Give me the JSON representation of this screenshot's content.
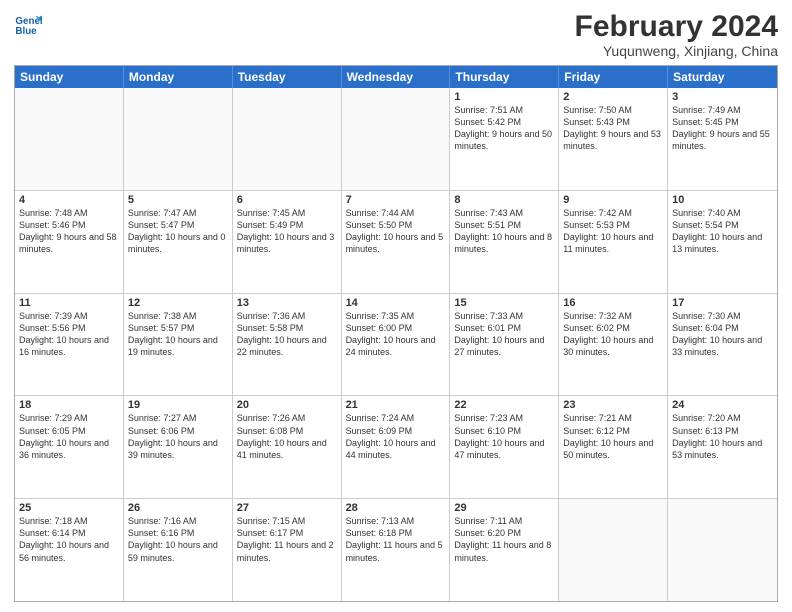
{
  "header": {
    "logo_line1": "General",
    "logo_line2": "Blue",
    "month_year": "February 2024",
    "location": "Yuqunweng, Xinjiang, China"
  },
  "days_of_week": [
    "Sunday",
    "Monday",
    "Tuesday",
    "Wednesday",
    "Thursday",
    "Friday",
    "Saturday"
  ],
  "rows": [
    [
      {
        "day": "",
        "info": ""
      },
      {
        "day": "",
        "info": ""
      },
      {
        "day": "",
        "info": ""
      },
      {
        "day": "",
        "info": ""
      },
      {
        "day": "1",
        "info": "Sunrise: 7:51 AM\nSunset: 5:42 PM\nDaylight: 9 hours and 50 minutes."
      },
      {
        "day": "2",
        "info": "Sunrise: 7:50 AM\nSunset: 5:43 PM\nDaylight: 9 hours and 53 minutes."
      },
      {
        "day": "3",
        "info": "Sunrise: 7:49 AM\nSunset: 5:45 PM\nDaylight: 9 hours and 55 minutes."
      }
    ],
    [
      {
        "day": "4",
        "info": "Sunrise: 7:48 AM\nSunset: 5:46 PM\nDaylight: 9 hours and 58 minutes."
      },
      {
        "day": "5",
        "info": "Sunrise: 7:47 AM\nSunset: 5:47 PM\nDaylight: 10 hours and 0 minutes."
      },
      {
        "day": "6",
        "info": "Sunrise: 7:45 AM\nSunset: 5:49 PM\nDaylight: 10 hours and 3 minutes."
      },
      {
        "day": "7",
        "info": "Sunrise: 7:44 AM\nSunset: 5:50 PM\nDaylight: 10 hours and 5 minutes."
      },
      {
        "day": "8",
        "info": "Sunrise: 7:43 AM\nSunset: 5:51 PM\nDaylight: 10 hours and 8 minutes."
      },
      {
        "day": "9",
        "info": "Sunrise: 7:42 AM\nSunset: 5:53 PM\nDaylight: 10 hours and 11 minutes."
      },
      {
        "day": "10",
        "info": "Sunrise: 7:40 AM\nSunset: 5:54 PM\nDaylight: 10 hours and 13 minutes."
      }
    ],
    [
      {
        "day": "11",
        "info": "Sunrise: 7:39 AM\nSunset: 5:56 PM\nDaylight: 10 hours and 16 minutes."
      },
      {
        "day": "12",
        "info": "Sunrise: 7:38 AM\nSunset: 5:57 PM\nDaylight: 10 hours and 19 minutes."
      },
      {
        "day": "13",
        "info": "Sunrise: 7:36 AM\nSunset: 5:58 PM\nDaylight: 10 hours and 22 minutes."
      },
      {
        "day": "14",
        "info": "Sunrise: 7:35 AM\nSunset: 6:00 PM\nDaylight: 10 hours and 24 minutes."
      },
      {
        "day": "15",
        "info": "Sunrise: 7:33 AM\nSunset: 6:01 PM\nDaylight: 10 hours and 27 minutes."
      },
      {
        "day": "16",
        "info": "Sunrise: 7:32 AM\nSunset: 6:02 PM\nDaylight: 10 hours and 30 minutes."
      },
      {
        "day": "17",
        "info": "Sunrise: 7:30 AM\nSunset: 6:04 PM\nDaylight: 10 hours and 33 minutes."
      }
    ],
    [
      {
        "day": "18",
        "info": "Sunrise: 7:29 AM\nSunset: 6:05 PM\nDaylight: 10 hours and 36 minutes."
      },
      {
        "day": "19",
        "info": "Sunrise: 7:27 AM\nSunset: 6:06 PM\nDaylight: 10 hours and 39 minutes."
      },
      {
        "day": "20",
        "info": "Sunrise: 7:26 AM\nSunset: 6:08 PM\nDaylight: 10 hours and 41 minutes."
      },
      {
        "day": "21",
        "info": "Sunrise: 7:24 AM\nSunset: 6:09 PM\nDaylight: 10 hours and 44 minutes."
      },
      {
        "day": "22",
        "info": "Sunrise: 7:23 AM\nSunset: 6:10 PM\nDaylight: 10 hours and 47 minutes."
      },
      {
        "day": "23",
        "info": "Sunrise: 7:21 AM\nSunset: 6:12 PM\nDaylight: 10 hours and 50 minutes."
      },
      {
        "day": "24",
        "info": "Sunrise: 7:20 AM\nSunset: 6:13 PM\nDaylight: 10 hours and 53 minutes."
      }
    ],
    [
      {
        "day": "25",
        "info": "Sunrise: 7:18 AM\nSunset: 6:14 PM\nDaylight: 10 hours and 56 minutes."
      },
      {
        "day": "26",
        "info": "Sunrise: 7:16 AM\nSunset: 6:16 PM\nDaylight: 10 hours and 59 minutes."
      },
      {
        "day": "27",
        "info": "Sunrise: 7:15 AM\nSunset: 6:17 PM\nDaylight: 11 hours and 2 minutes."
      },
      {
        "day": "28",
        "info": "Sunrise: 7:13 AM\nSunset: 6:18 PM\nDaylight: 11 hours and 5 minutes."
      },
      {
        "day": "29",
        "info": "Sunrise: 7:11 AM\nSunset: 6:20 PM\nDaylight: 11 hours and 8 minutes."
      },
      {
        "day": "",
        "info": ""
      },
      {
        "day": "",
        "info": ""
      }
    ]
  ]
}
